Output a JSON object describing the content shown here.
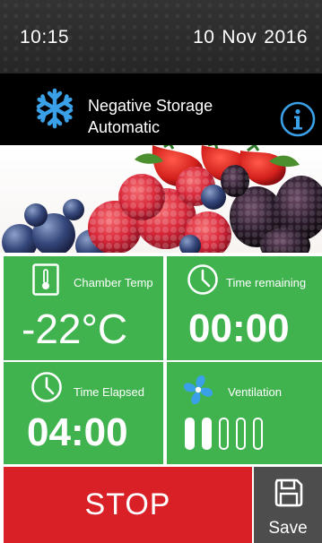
{
  "status": {
    "time": "10:15",
    "date_day": "10",
    "date_month": "Nov",
    "date_year": "2016"
  },
  "mode": {
    "line1": "Negative Storage",
    "line2": "Automatic",
    "icon": "snowflake-icon",
    "info_icon": "info-icon"
  },
  "tiles": {
    "chamber_temp": {
      "label": "Chamber Temp",
      "value": "-22",
      "unit": "°C",
      "icon": "thermometer-icon"
    },
    "time_remaining": {
      "label": "Time remaining",
      "value": "00:00",
      "icon": "clock-icon"
    },
    "time_elapsed": {
      "label": "Time Elapsed",
      "value": "04:00",
      "icon": "clock-icon"
    },
    "ventilation": {
      "label": "Ventilation",
      "icon": "fan-icon",
      "level": 2,
      "max_level": 5
    }
  },
  "actions": {
    "stop_label": "STOP",
    "save_label": "Save",
    "save_icon": "floppy-disk-icon"
  },
  "colors": {
    "tile_green": "#40b34f",
    "stop_red": "#d92027",
    "accent_blue": "#3aa0e8",
    "header_dark": "#2e2e2e"
  }
}
